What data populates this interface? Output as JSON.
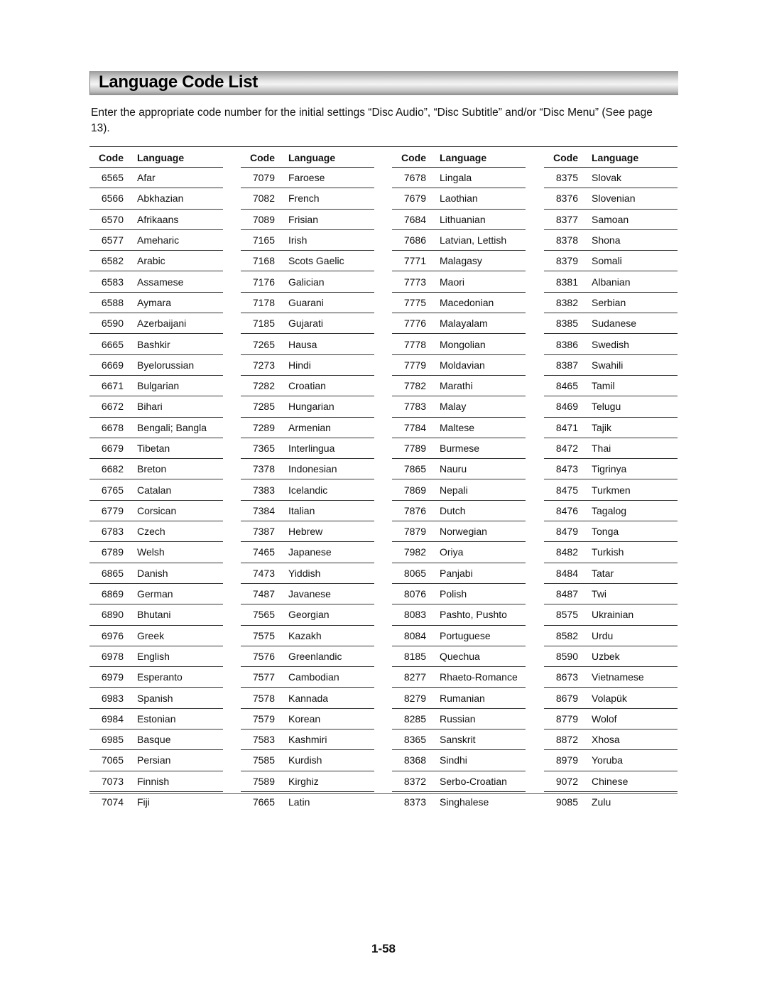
{
  "title": "Language Code List",
  "intro": "Enter the appropriate code number for the initial settings “Disc Audio”, “Disc Subtitle” and/or “Disc Menu” (See page 13).",
  "headers": {
    "code": "Code",
    "language": "Language"
  },
  "columns": [
    [
      [
        "6565",
        "Afar"
      ],
      [
        "6566",
        "Abkhazian"
      ],
      [
        "6570",
        "Afrikaans"
      ],
      [
        "6577",
        "Ameharic"
      ],
      [
        "6582",
        "Arabic"
      ],
      [
        "6583",
        "Assamese"
      ],
      [
        "6588",
        "Aymara"
      ],
      [
        "6590",
        "Azerbaijani"
      ],
      [
        "6665",
        "Bashkir"
      ],
      [
        "6669",
        "Byelorussian"
      ],
      [
        "6671",
        "Bulgarian"
      ],
      [
        "6672",
        "Bihari"
      ],
      [
        "6678",
        "Bengali; Bangla"
      ],
      [
        "6679",
        "Tibetan"
      ],
      [
        "6682",
        "Breton"
      ],
      [
        "6765",
        "Catalan"
      ],
      [
        "6779",
        "Corsican"
      ],
      [
        "6783",
        "Czech"
      ],
      [
        "6789",
        "Welsh"
      ],
      [
        "6865",
        "Danish"
      ],
      [
        "6869",
        "German"
      ],
      [
        "6890",
        "Bhutani"
      ],
      [
        "6976",
        "Greek"
      ],
      [
        "6978",
        "English"
      ],
      [
        "6979",
        "Esperanto"
      ],
      [
        "6983",
        "Spanish"
      ],
      [
        "6984",
        "Estonian"
      ],
      [
        "6985",
        "Basque"
      ],
      [
        "7065",
        "Persian"
      ],
      [
        "7073",
        "Finnish"
      ],
      [
        "7074",
        "Fiji"
      ]
    ],
    [
      [
        "7079",
        "Faroese"
      ],
      [
        "7082",
        "French"
      ],
      [
        "7089",
        "Frisian"
      ],
      [
        "7165",
        "Irish"
      ],
      [
        "7168",
        "Scots Gaelic"
      ],
      [
        "7176",
        "Galician"
      ],
      [
        "7178",
        "Guarani"
      ],
      [
        "7185",
        "Gujarati"
      ],
      [
        "7265",
        "Hausa"
      ],
      [
        "7273",
        "Hindi"
      ],
      [
        "7282",
        "Croatian"
      ],
      [
        "7285",
        "Hungarian"
      ],
      [
        "7289",
        "Armenian"
      ],
      [
        "7365",
        "Interlingua"
      ],
      [
        "7378",
        "Indonesian"
      ],
      [
        "7383",
        "Icelandic"
      ],
      [
        "7384",
        "Italian"
      ],
      [
        "7387",
        "Hebrew"
      ],
      [
        "7465",
        "Japanese"
      ],
      [
        "7473",
        "Yiddish"
      ],
      [
        "7487",
        "Javanese"
      ],
      [
        "7565",
        "Georgian"
      ],
      [
        "7575",
        "Kazakh"
      ],
      [
        "7576",
        "Greenlandic"
      ],
      [
        "7577",
        "Cambodian"
      ],
      [
        "7578",
        "Kannada"
      ],
      [
        "7579",
        "Korean"
      ],
      [
        "7583",
        "Kashmiri"
      ],
      [
        "7585",
        "Kurdish"
      ],
      [
        "7589",
        "Kirghiz"
      ],
      [
        "7665",
        "Latin"
      ]
    ],
    [
      [
        "7678",
        "Lingala"
      ],
      [
        "7679",
        "Laothian"
      ],
      [
        "7684",
        "Lithuanian"
      ],
      [
        "7686",
        "Latvian, Lettish"
      ],
      [
        "7771",
        "Malagasy"
      ],
      [
        "7773",
        "Maori"
      ],
      [
        "7775",
        "Macedonian"
      ],
      [
        "7776",
        "Malayalam"
      ],
      [
        "7778",
        "Mongolian"
      ],
      [
        "7779",
        "Moldavian"
      ],
      [
        "7782",
        "Marathi"
      ],
      [
        "7783",
        "Malay"
      ],
      [
        "7784",
        "Maltese"
      ],
      [
        "7789",
        "Burmese"
      ],
      [
        "7865",
        "Nauru"
      ],
      [
        "7869",
        "Nepali"
      ],
      [
        "7876",
        "Dutch"
      ],
      [
        "7879",
        "Norwegian"
      ],
      [
        "7982",
        "Oriya"
      ],
      [
        "8065",
        "Panjabi"
      ],
      [
        "8076",
        "Polish"
      ],
      [
        "8083",
        "Pashto, Pushto"
      ],
      [
        "8084",
        "Portuguese"
      ],
      [
        "8185",
        "Quechua"
      ],
      [
        "8277",
        "Rhaeto-Romance"
      ],
      [
        "8279",
        "Rumanian"
      ],
      [
        "8285",
        "Russian"
      ],
      [
        "8365",
        "Sanskrit"
      ],
      [
        "8368",
        "Sindhi"
      ],
      [
        "8372",
        "Serbo-Croatian"
      ],
      [
        "8373",
        "Singhalese"
      ]
    ],
    [
      [
        "8375",
        "Slovak"
      ],
      [
        "8376",
        "Slovenian"
      ],
      [
        "8377",
        "Samoan"
      ],
      [
        "8378",
        "Shona"
      ],
      [
        "8379",
        "Somali"
      ],
      [
        "8381",
        "Albanian"
      ],
      [
        "8382",
        "Serbian"
      ],
      [
        "8385",
        "Sudanese"
      ],
      [
        "8386",
        "Swedish"
      ],
      [
        "8387",
        "Swahili"
      ],
      [
        "8465",
        "Tamil"
      ],
      [
        "8469",
        "Telugu"
      ],
      [
        "8471",
        "Tajik"
      ],
      [
        "8472",
        "Thai"
      ],
      [
        "8473",
        "Tigrinya"
      ],
      [
        "8475",
        "Turkmen"
      ],
      [
        "8476",
        "Tagalog"
      ],
      [
        "8479",
        "Tonga"
      ],
      [
        "8482",
        "Turkish"
      ],
      [
        "8484",
        "Tatar"
      ],
      [
        "8487",
        "Twi"
      ],
      [
        "8575",
        "Ukrainian"
      ],
      [
        "8582",
        "Urdu"
      ],
      [
        "8590",
        "Uzbek"
      ],
      [
        "8673",
        "Vietnamese"
      ],
      [
        "8679",
        "Volapük"
      ],
      [
        "8779",
        "Wolof"
      ],
      [
        "8872",
        "Xhosa"
      ],
      [
        "8979",
        "Yoruba"
      ],
      [
        "9072",
        "Chinese"
      ],
      [
        "9085",
        "Zulu"
      ]
    ]
  ],
  "page_number": "1-58"
}
